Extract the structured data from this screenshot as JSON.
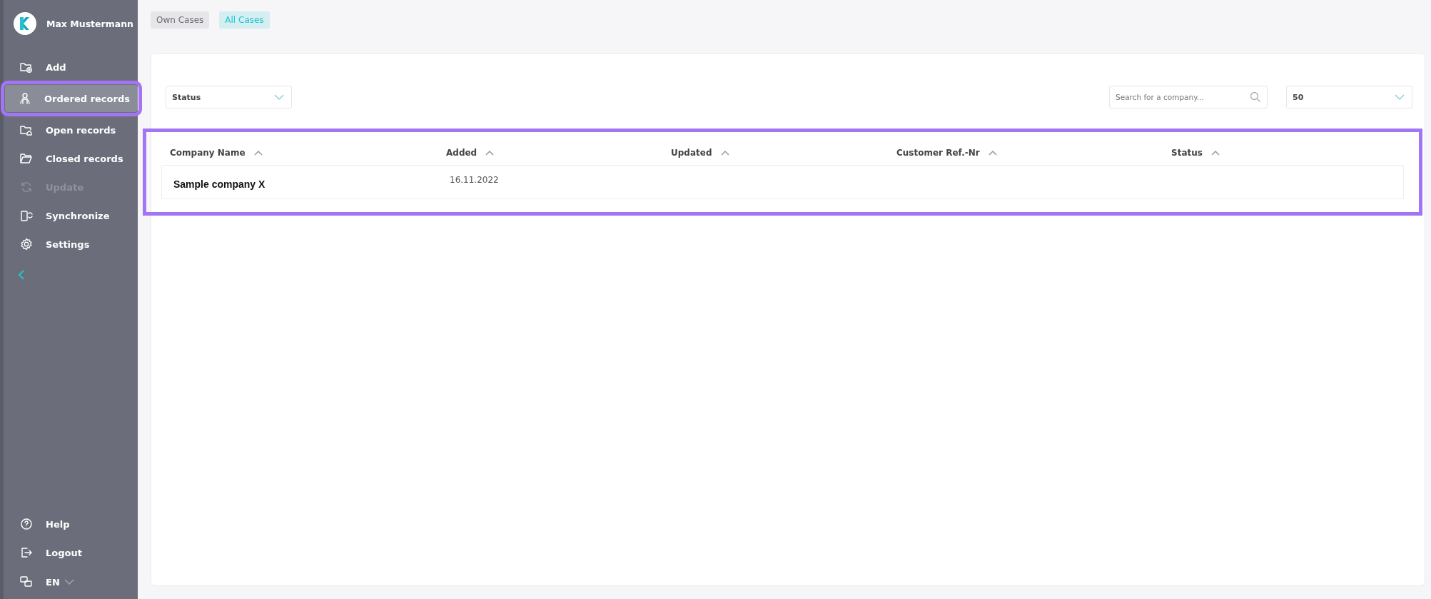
{
  "sidebar": {
    "user_name": "Max Mustermann",
    "items": [
      {
        "label": "Add",
        "selected": false,
        "disabled": false,
        "highlighted": false
      },
      {
        "label": "Ordered records",
        "selected": true,
        "disabled": false,
        "highlighted": true
      },
      {
        "label": "Open records",
        "selected": false,
        "disabled": false,
        "highlighted": false
      },
      {
        "label": "Closed records",
        "selected": false,
        "disabled": false,
        "highlighted": false
      },
      {
        "label": "Update",
        "selected": false,
        "disabled": true,
        "highlighted": false
      },
      {
        "label": "Synchronize",
        "selected": false,
        "disabled": false,
        "highlighted": false
      },
      {
        "label": "Settings",
        "selected": false,
        "disabled": false,
        "highlighted": false
      }
    ],
    "bottom_items": [
      {
        "label": "Help"
      },
      {
        "label": "Logout"
      }
    ],
    "language": "EN"
  },
  "tabs": [
    {
      "label": "Own Cases",
      "selected": false
    },
    {
      "label": "All Cases",
      "selected": true
    }
  ],
  "filters": {
    "status_dropdown": "Status",
    "search": {
      "placeholder": "Search for a company..."
    },
    "page_size": "50"
  },
  "table": {
    "highlighted": true,
    "columns": [
      "Company Name",
      "Added",
      "Updated",
      "Customer Ref.-Nr",
      "Status"
    ],
    "rows": [
      {
        "company_name": "Sample company X",
        "added": "16.11.2022"
      }
    ]
  }
}
